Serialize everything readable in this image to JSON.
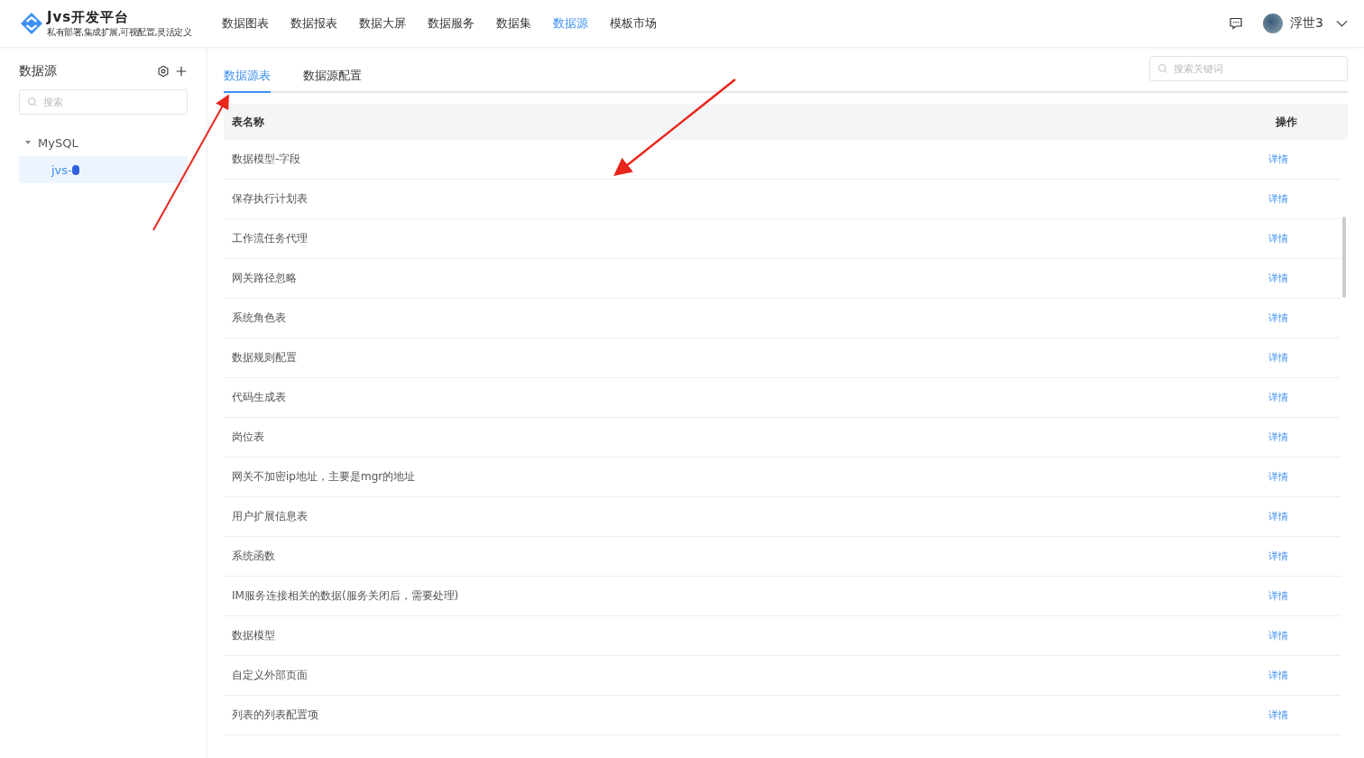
{
  "brand": {
    "name": "Jvs开发平台",
    "slogan": "私有部署,集成扩展,可视配置,灵活定义"
  },
  "nav": [
    {
      "label": "数据图表",
      "selected": false
    },
    {
      "label": "数据报表",
      "selected": false
    },
    {
      "label": "数据大屏",
      "selected": false
    },
    {
      "label": "数据服务",
      "selected": false
    },
    {
      "label": "数据集",
      "selected": false
    },
    {
      "label": "数据源",
      "selected": true
    },
    {
      "label": "模板市场",
      "selected": false
    }
  ],
  "user": {
    "name": "浮世3"
  },
  "sidebar": {
    "title": "数据源",
    "search": {
      "placeholder": "搜索"
    },
    "tree": [
      {
        "label": "MySQL",
        "expanded": true,
        "selected": false,
        "children": [
          {
            "label": "jvs-",
            "selected": true
          }
        ]
      }
    ]
  },
  "tabs": [
    {
      "label": "数据源表",
      "selected": true
    },
    {
      "label": "数据源配置",
      "selected": false
    }
  ],
  "search": {
    "placeholder": "搜索关键词"
  },
  "table": {
    "columns": [
      "表名称",
      "操作"
    ],
    "rows": [
      {
        "name": "数据模型-字段",
        "action": "详情"
      },
      {
        "name": "保存执行计划表",
        "action": "详情"
      },
      {
        "name": "工作流任务代理",
        "action": "详情"
      },
      {
        "name": "网关路径忽略",
        "action": "详情"
      },
      {
        "name": "系统角色表",
        "action": "详情"
      },
      {
        "name": "数据规则配置",
        "action": "详情"
      },
      {
        "name": "代码生成表",
        "action": "详情"
      },
      {
        "name": "岗位表",
        "action": "详情"
      },
      {
        "name": "网关不加密ip地址，主要是mgr的地址",
        "action": "详情"
      },
      {
        "name": "用户扩展信息表",
        "action": "详情"
      },
      {
        "name": "系统函数",
        "action": "详情"
      },
      {
        "name": "IM服务连接相关的数据(服务关闭后，需要处理)",
        "action": "详情"
      },
      {
        "name": "数据模型",
        "action": "详情"
      },
      {
        "name": "自定义外部页面",
        "action": "详情"
      },
      {
        "name": "列表的列表配置项",
        "action": "详情"
      }
    ]
  }
}
